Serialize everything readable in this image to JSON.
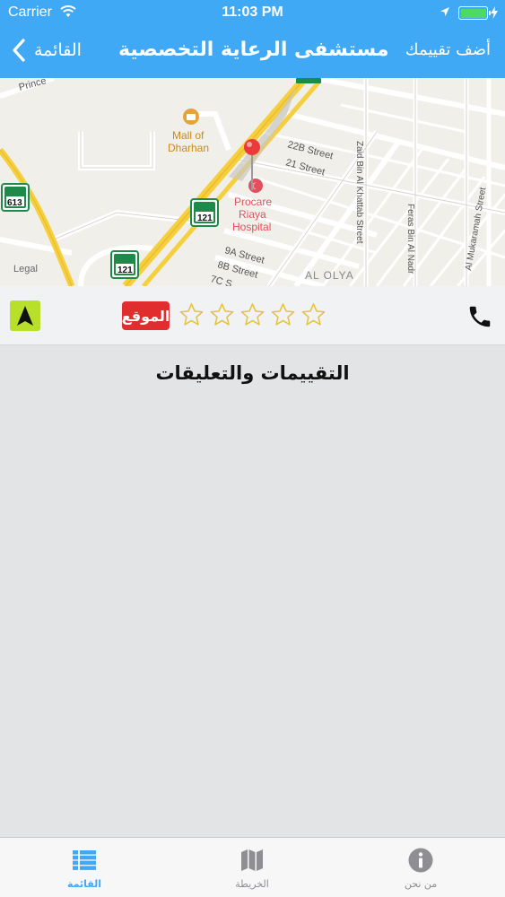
{
  "status_bar": {
    "carrier": "Carrier",
    "time": "11:03 PM"
  },
  "nav_bar": {
    "back_label": "القائمة",
    "title": "مستشفى الرعاية التخصصية",
    "add_rating_label": "أضف تقييمك"
  },
  "map": {
    "labels": {
      "street_top": "Prince",
      "mall": "Mall of\nDharhan",
      "mall_line1": "Mall of",
      "mall_line2": "Dharhan",
      "hospital_line1": "Procare",
      "hospital_line2": "Riaya",
      "hospital_line3": "Hospital",
      "street_22b": "22B Street",
      "street_21": "21 Street",
      "street_9a": "9A Street",
      "street_8b": "8B Street",
      "street_7c": "7C S",
      "zaid": "Zaid Bin Al Khattab Street",
      "feras": "Feras Bin Al Nadr",
      "mukaramah": "Al Mukaramah Street",
      "district": "AL OLYA",
      "legal": "Legal"
    },
    "route_shields": [
      "613",
      "121",
      "121"
    ],
    "colors": {
      "highway": "#f6cf3f",
      "pin": "#ea3a3a",
      "poi_hospital": "#e2505e",
      "poi_mall": "#c88a1a",
      "shield": "#1e8a4a"
    }
  },
  "actions": {
    "site_label": "الموقع",
    "rating_value": 0,
    "rating_max": 5,
    "colors": {
      "site_badge": "#e12d2d",
      "nav_arrow_bg": "#b8e02a",
      "star_outline": "#e6c33c"
    }
  },
  "section": {
    "title": "التقييمات والتعليقات"
  },
  "tabbar": {
    "tabs": [
      {
        "label": "القائمة",
        "icon": "list-icon",
        "active": true
      },
      {
        "label": "الخريطة",
        "icon": "map-icon",
        "active": false
      },
      {
        "label": "من نحن",
        "icon": "info-icon",
        "active": false
      }
    ],
    "colors": {
      "active": "#3fa9f5",
      "inactive": "#8e8e93"
    }
  },
  "theme": {
    "accent": "#3fa9f5"
  }
}
